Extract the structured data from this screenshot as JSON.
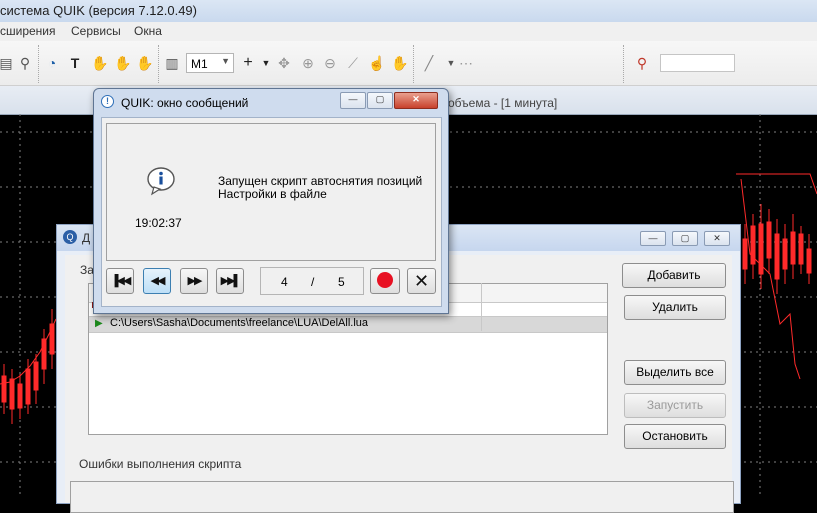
{
  "app": {
    "title": "система QUIK (версия 7.12.0.49)",
    "menu": [
      "сширения",
      "Сервисы",
      "Окна"
    ],
    "timeframe": "M1",
    "chart_tab_label": "объема - [1 минута]",
    "search_placeholder": ""
  },
  "scripts_window": {
    "title_partial": "Д",
    "list_label_partial": "За",
    "script_path": "C:\\Users\\Sasha\\Documents\\freelance\\LUA\\DelAll.lua",
    "buttons": {
      "add": "Добавить",
      "delete": "Удалить",
      "select_all": "Выделить все",
      "run": "Запустить",
      "stop": "Остановить"
    },
    "errors_label": "Ошибки выполнения скрипта"
  },
  "message_window": {
    "title": "QUIK: окно сообщений",
    "message_line1": "Запущен скрипт автоснятия позиций",
    "message_line2": "Настройки в файле",
    "time": "19:02:37",
    "current": "4",
    "separator": "/",
    "total": "5"
  },
  "colors": {
    "chart_bg": "#000000",
    "candle_red": "#ff2a2a",
    "grid": "#7f7f7f",
    "accent_red": "#e81123"
  },
  "icons": [
    "info-icon",
    "first-icon",
    "prev-icon",
    "next-icon",
    "last-icon",
    "record-icon",
    "close-x-icon",
    "search-icon",
    "hand-icon",
    "crosshair-icon",
    "play-marker-icon",
    "minimize-icon",
    "maximize-icon",
    "close-icon"
  ]
}
